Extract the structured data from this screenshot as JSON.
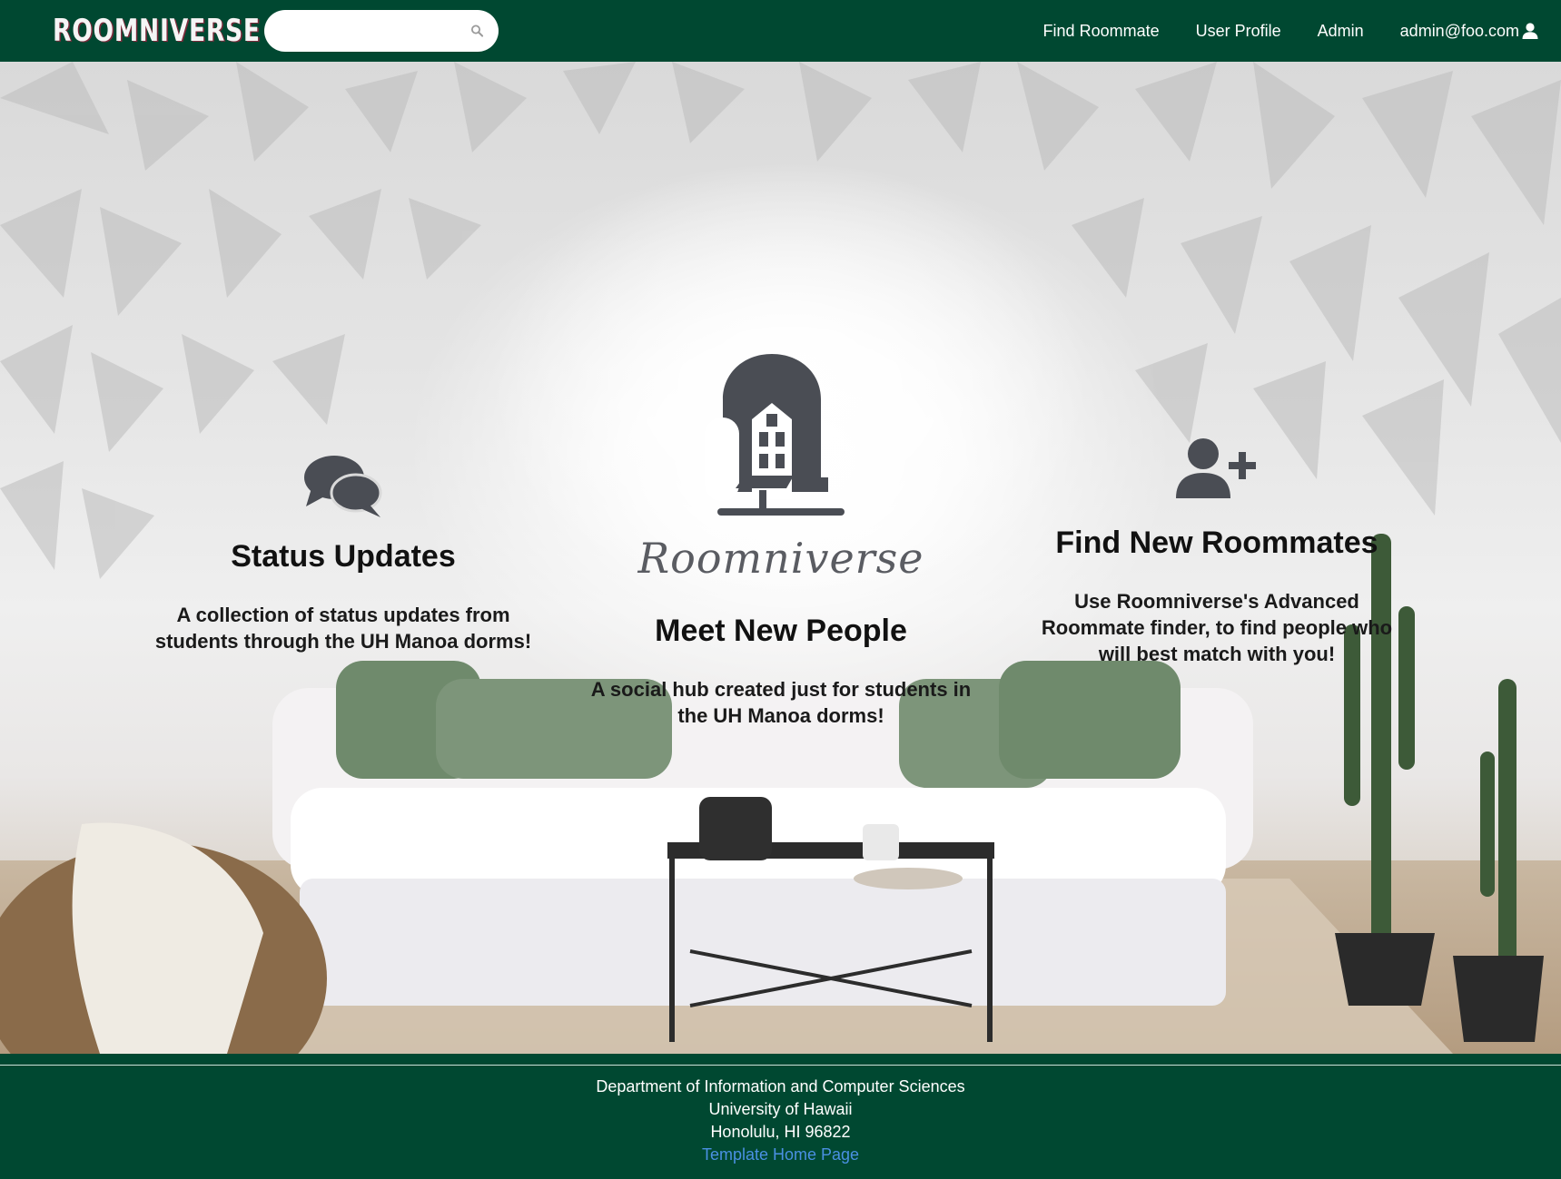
{
  "navbar": {
    "brand": "ROOMNIVERSE",
    "search": {
      "placeholder": "",
      "value": ""
    },
    "links": [
      {
        "label": "Find Roommate"
      },
      {
        "label": "User Profile"
      },
      {
        "label": "Admin"
      },
      {
        "label": "admin@foo.com"
      }
    ]
  },
  "hero": {
    "logo_text": "Roomniverse",
    "features": [
      {
        "icon": "comments-icon",
        "title": "Status Updates",
        "description": "A collection of status updates from students through the UH Manoa dorms!"
      },
      {
        "icon": "roomniverse-logo",
        "title": "Meet New People",
        "description": "A social hub created just for students in the UH Manoa dorms!"
      },
      {
        "icon": "user-plus-icon",
        "title": "Find New Roommates",
        "description": "Use Roomniverse's Advanced Roommate finder, to find people who will best match with you!"
      }
    ]
  },
  "footer": {
    "line1": "Department of Information and Computer Sciences",
    "line2": "University of Hawaii",
    "line3": "Honolulu, HI 96822",
    "link": "Template Home Page"
  },
  "colors": {
    "primary": "#004831",
    "link": "#4a90e2",
    "icon": "#4a4d54"
  }
}
